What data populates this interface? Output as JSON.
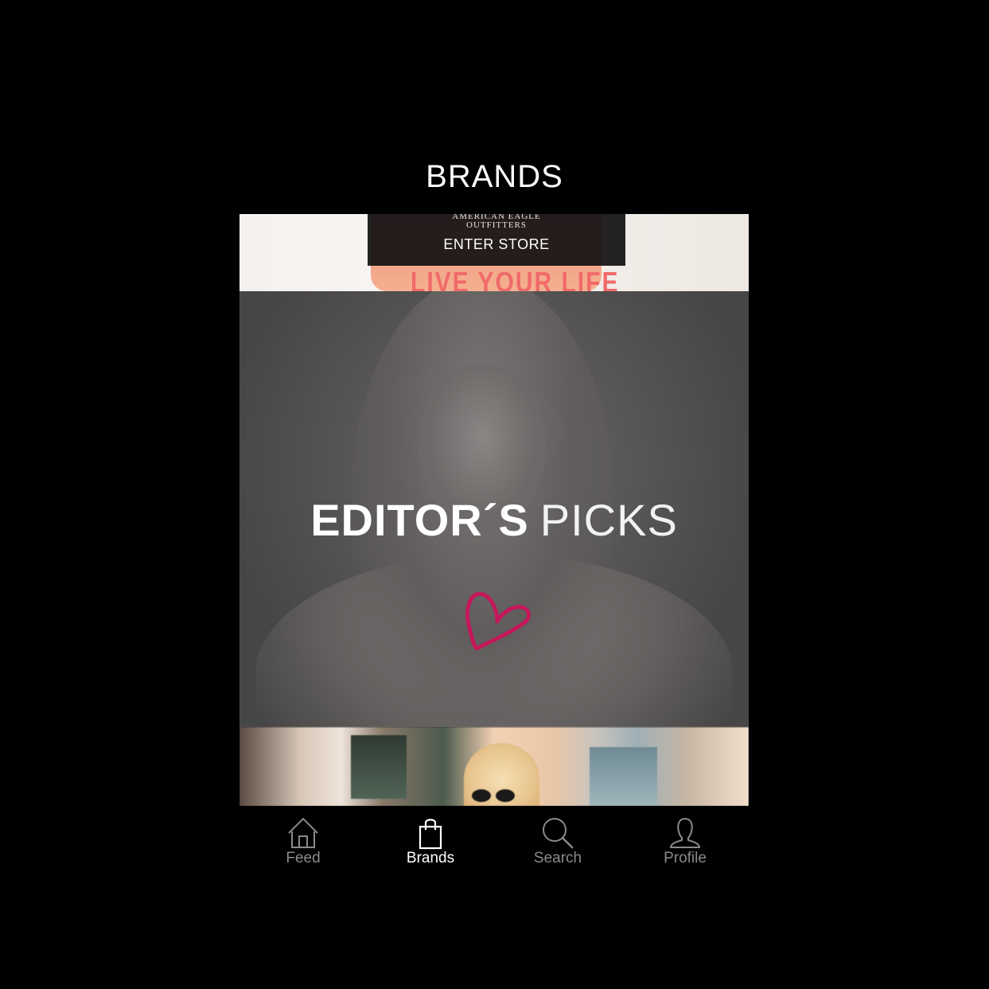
{
  "header": {
    "title": "BRANDS"
  },
  "brand_card": {
    "logo_line1": "AMERICAN EAGLE",
    "logo_line2": "OUTFITTERS",
    "cta": "ENTER STORE",
    "shirt_text": "LIVE YOUR LIFE"
  },
  "picks_card": {
    "title_bold": "EDITOR´S",
    "title_light": "PICKS",
    "accent_color": "#c4185a",
    "icon": "heart-icon"
  },
  "tabbar": {
    "tabs": [
      {
        "label": "Feed",
        "icon": "home-icon",
        "active": false
      },
      {
        "label": "Brands",
        "icon": "shopping-bag-icon",
        "active": true
      },
      {
        "label": "Search",
        "icon": "search-icon",
        "active": false
      },
      {
        "label": "Profile",
        "icon": "profile-icon",
        "active": false
      }
    ],
    "active_color": "#ffffff",
    "inactive_color": "#8a8a8a"
  }
}
